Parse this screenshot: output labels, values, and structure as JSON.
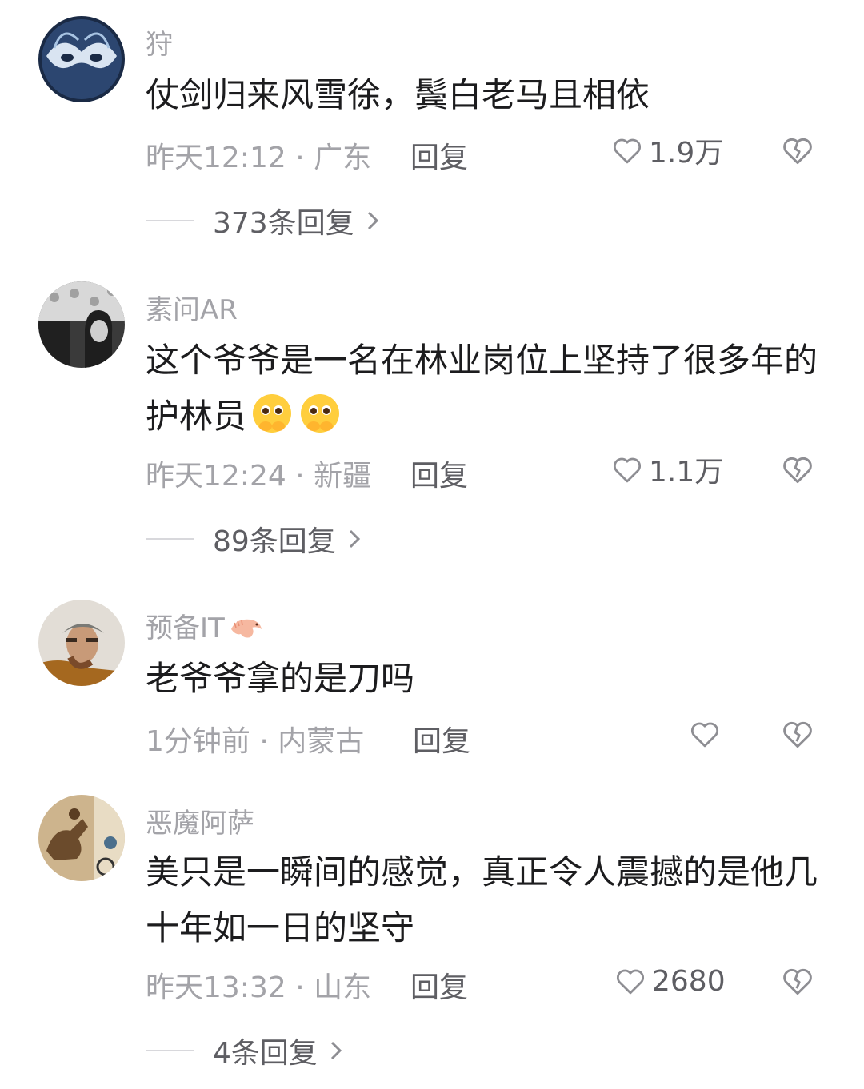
{
  "comments": [
    {
      "username": "狩",
      "text": "仗剑归来风雪徐，鬓白老马且相依",
      "time": "昨天12:12 · 广东",
      "reply_label": "回复",
      "likes": "1.9万",
      "replies": "373条回复"
    },
    {
      "username": "素问AR",
      "text": "这个爷爷是一名在林业岗位上坚持了很多年的护林员",
      "time": "昨天12:24 · 新疆",
      "reply_label": "回复",
      "likes": "1.1万",
      "replies": "89条回复"
    },
    {
      "username": "预备IT",
      "text": "老爷爷拿的是刀吗",
      "time": "1分钟前 · 内蒙古",
      "reply_label": "回复",
      "likes": ""
    },
    {
      "username": "恶魔阿萨",
      "text": "美只是一瞬间的感觉，真正令人震撼的是他几十年如一日的坚守",
      "time": "昨天13:32 · 山东",
      "reply_label": "回复",
      "likes": "2680",
      "replies": "4条回复"
    }
  ],
  "icons": {
    "like": "heart-outline-icon",
    "dislike": "broken-heart-icon",
    "more": "chevron-right-icon",
    "emoji": "pleading-face-emoji",
    "badge": "shrimp-icon"
  },
  "colors": {
    "username": "#a3a3a8",
    "text": "#1c1c1e",
    "meta": "#a3a3a8",
    "action": "#5e5e63"
  }
}
